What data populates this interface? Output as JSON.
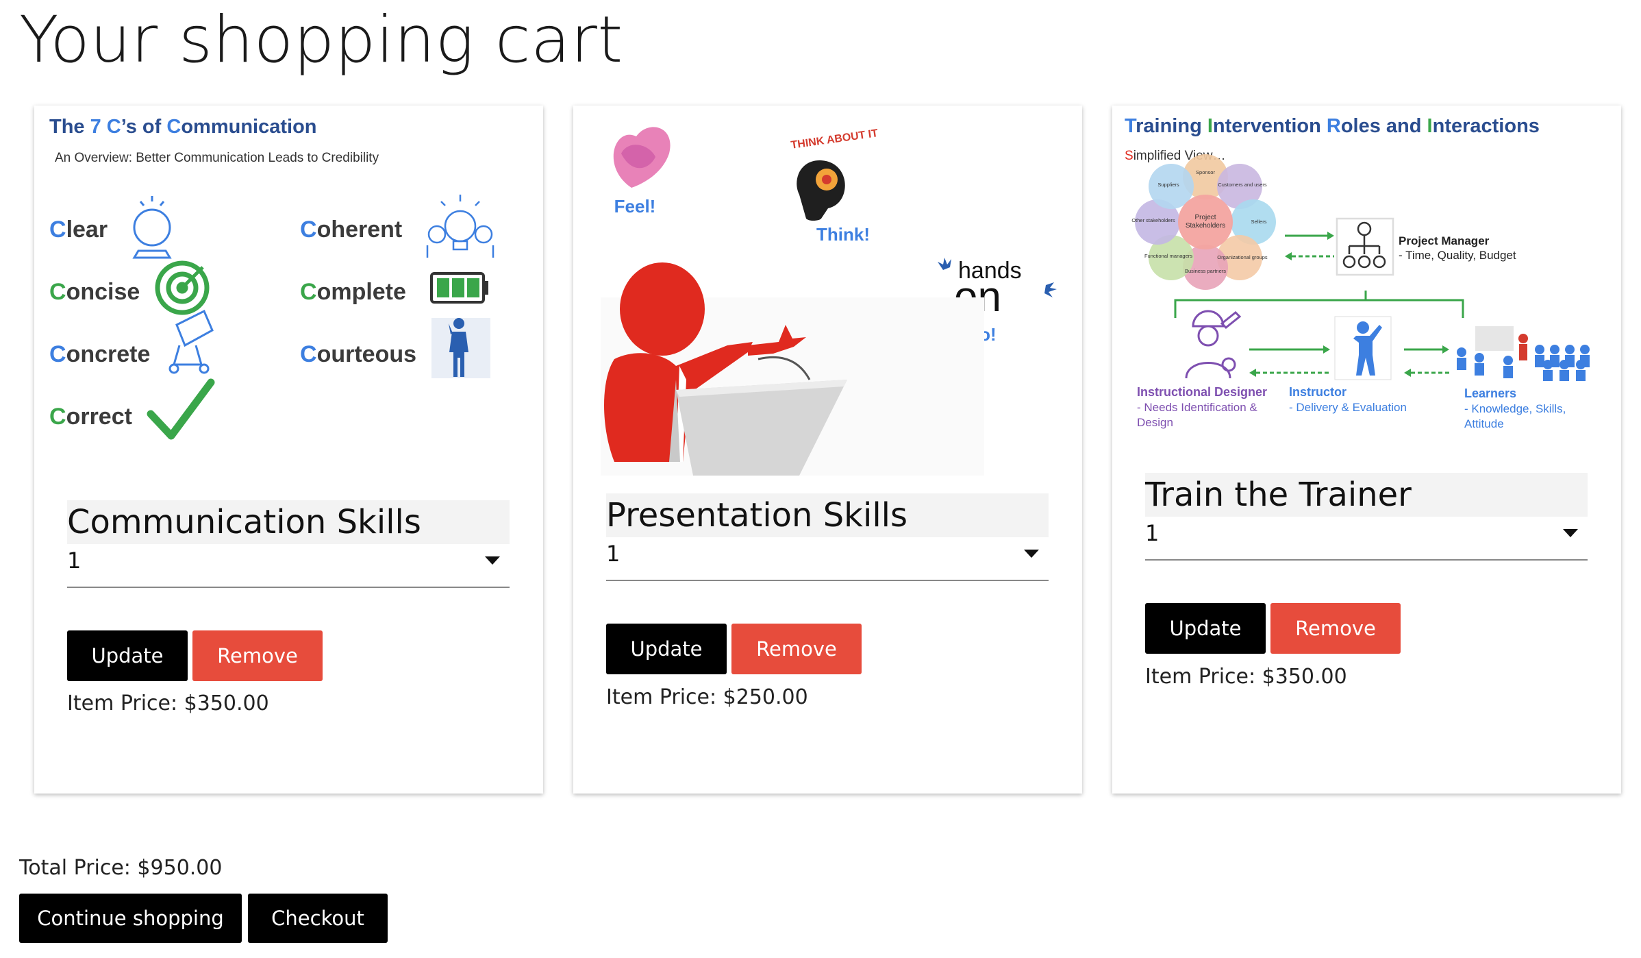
{
  "page": {
    "title": "Your shopping cart",
    "total_label": "Total Price: $950.00",
    "continue_label": "Continue shopping",
    "checkout_label": "Checkout"
  },
  "colors": {
    "remove": "#e74c3c",
    "primary": "#000000",
    "blue": "#3d7fe0",
    "green": "#3aa64a"
  },
  "items": [
    {
      "name": "Communication Skills",
      "quantity": "1",
      "update_label": "Update",
      "remove_label": "Remove",
      "price_label": "Item Price: $350.00",
      "image": {
        "title_parts": [
          "The ",
          "7 C",
          "’s of ",
          "C",
          "ommunication"
        ],
        "subtitle": "An Overview: Better Communication Leads to Credibility",
        "words": [
          {
            "initial": "C",
            "rest": "lear"
          },
          {
            "initial": "C",
            "rest": "oncise"
          },
          {
            "initial": "C",
            "rest": "oncrete"
          },
          {
            "initial": "C",
            "rest": "orrect"
          },
          {
            "initial": "C",
            "rest": "oherent"
          },
          {
            "initial": "C",
            "rest": "omplete"
          },
          {
            "initial": "C",
            "rest": "ourteous"
          }
        ]
      }
    },
    {
      "name": "Presentation Skills",
      "quantity": "1",
      "update_label": "Update",
      "remove_label": "Remove",
      "price_label": "Item Price: $250.00",
      "image": {
        "feel": "Feel!",
        "think": "Think!",
        "think_about": "THINK ABOUT IT",
        "hands": "hands",
        "on": "on",
        "do": "Do!"
      }
    },
    {
      "name": "Train the Trainer",
      "quantity": "1",
      "update_label": "Update",
      "remove_label": "Remove",
      "price_label": "Item Price: $350.00",
      "image": {
        "title_parts": [
          "T",
          "raining ",
          "I",
          "ntervention ",
          "R",
          "oles and ",
          "I",
          "nteractions"
        ],
        "simplified_initial": "S",
        "simplified_rest": "implified View…",
        "stakeholders": [
          "Sponsor",
          "Customers and users",
          "Sellers",
          "Organizational groups",
          "Business partners",
          "Functional managers",
          "Other stakeholders",
          "Suppliers"
        ],
        "center": [
          "Project",
          "Stakeholders"
        ],
        "pm_title": "Project Manager",
        "pm_detail": "- Time, Quality, Budget",
        "designer_title": "Instructional Designer",
        "designer_line1": "- Needs Identification &",
        "designer_line2": "Design",
        "instructor_title": "Instructor",
        "instructor_detail": "- Delivery & Evaluation",
        "learners_title": "Learners",
        "learners_line1": "- Knowledge, Skills,",
        "learners_line2": "Attitude"
      }
    }
  ]
}
